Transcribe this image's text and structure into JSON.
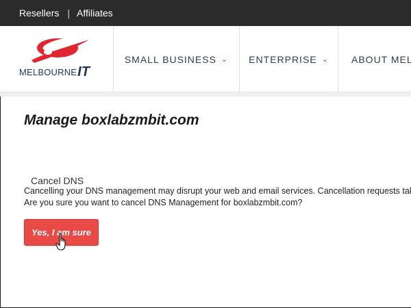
{
  "topbar": {
    "links": [
      "Resellers",
      "Affiliates"
    ],
    "separator": "|"
  },
  "brand": {
    "name_word": "MELBOURNE",
    "name_mark": "IT",
    "logo_colors": {
      "swoosh": "#e0262f",
      "text": "#1f3864"
    }
  },
  "nav": {
    "items": [
      {
        "label": "SMALL BUSINESS",
        "has_dropdown": true
      },
      {
        "label": "ENTERPRISE",
        "has_dropdown": true
      },
      {
        "label": "ABOUT MEL",
        "has_dropdown": false
      }
    ],
    "chevron_icon": "chevron-down-icon"
  },
  "main": {
    "title": "Manage boxlabzmbit.com",
    "section_label": "Cancel DNS",
    "warning_line": "Cancelling your DNS management may disrupt your web and email services. Cancellation requests take",
    "question_line": "Are you sure you want to cancel DNS Management for boxlabzmbit.com?",
    "confirm_button": "Yes, I am sure"
  },
  "colors": {
    "topbar_bg": "#2b2b2b",
    "accent_red": "#e0262f",
    "button_red": "#ea4a45",
    "nav_text": "#2f3b4a"
  },
  "cursor": {
    "icon": "hand-pointer-icon"
  }
}
